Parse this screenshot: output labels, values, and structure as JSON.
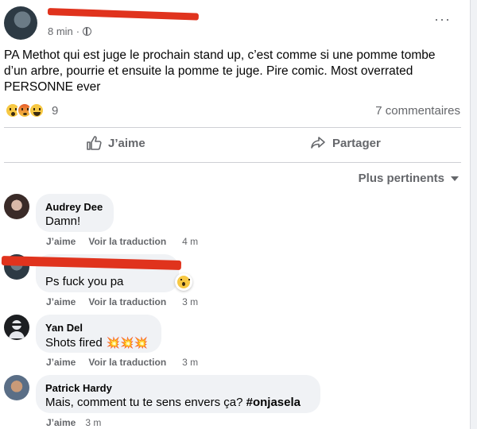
{
  "post": {
    "author": "",
    "time": "8 min",
    "separator": "·",
    "text": "PA Methot qui est juge le prochain stand up, c’est comme si une pomme tombe d’un arbre, pourrie et ensuite la pomme te juge. Pire comic. Most overrated PERSONNE ever",
    "more_label": "···",
    "reaction_count": "9",
    "comment_count": "7 commentaires",
    "reactions": [
      "wow-reaction-icon",
      "angry-reaction-icon",
      "haha-reaction-icon"
    ]
  },
  "actions": {
    "like_label": "J’aime",
    "share_label": "Partager"
  },
  "sort": {
    "label": "Plus pertinents"
  },
  "comments": [
    {
      "name": "Audrey Dee",
      "text": "Damn!",
      "like": "J’aime",
      "translate": "Voir la traduction",
      "time": "4 m"
    },
    {
      "name": "",
      "text": "Ps fuck you pa",
      "like": "J’aime",
      "translate": "Voir la traduction",
      "time": "3 m"
    },
    {
      "name": "Yan Del",
      "text": "Shots fired",
      "emojis": "💥💥💥",
      "like": "J’aime",
      "translate": "Voir la traduction",
      "time": "3 m"
    },
    {
      "name": "Patrick Hardy",
      "text": "Mais, comment tu te sens envers ça? ",
      "hashtag": "#onjasela",
      "like": "J’aime",
      "time": "3 m"
    }
  ],
  "colors": {
    "text": "#050505",
    "secondary": "#65676b",
    "bubble": "#f0f2f5",
    "redaction": "#e0331d"
  }
}
